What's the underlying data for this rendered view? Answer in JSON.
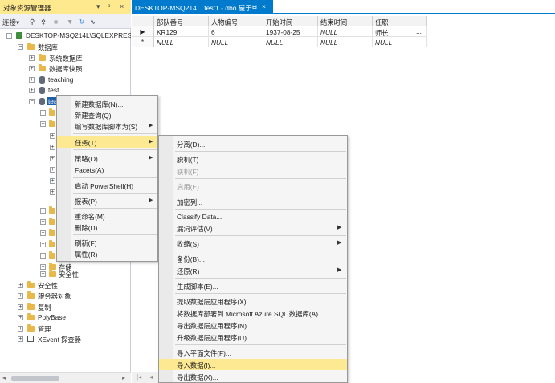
{
  "object_explorer": {
    "title": "对象资源管理器",
    "pin": "ㅈ",
    "float_pin": "ᵖ",
    "close": "×",
    "toolbar": {
      "connect": "连接▾",
      "icons": [
        "plug-icon",
        "disconnect-icon",
        "stop-icon",
        "filter-icon",
        "refresh-icon",
        "activity-icon"
      ]
    },
    "tree": {
      "server": "DESKTOP-MSQ214L\\SQLEXPRESS",
      "databases": "数据库",
      "system_db": "系统数据库",
      "snapshots": "数据库快照",
      "db1": "teaching",
      "db2": "test",
      "db3": "teaching",
      "storage": "存储",
      "security_sub": "安全性",
      "security": "安全性",
      "server_objects": "服务器对象",
      "replication": "复制",
      "polybase": "PolyBase",
      "management": "管理",
      "xevent": "XEvent 探查器"
    }
  },
  "doc_tab": {
    "title": "DESKTOP-MSQ214....test1 - dbo.屋于",
    "pin": "ㅂ",
    "close": "×"
  },
  "grid": {
    "columns": [
      "部队番号",
      "人物编号",
      "开始时间",
      "结束时间",
      "任职"
    ],
    "rows": [
      {
        "marker": "▶",
        "cells": [
          "KR129",
          "6",
          "1937-08-25",
          "NULL",
          "师长"
        ],
        "extra": "..."
      },
      {
        "marker": "*",
        "cells": [
          "NULL",
          "NULL",
          "NULL",
          "NULL",
          "NULL"
        ]
      }
    ]
  },
  "context_menu": {
    "items": [
      "新建数据库(N)...",
      "新建查询(Q)",
      "编写数据库脚本为(S)",
      "任务(T)",
      "策略(O)",
      "Facets(A)",
      "启动 PowerShell(H)",
      "报表(P)",
      "重命名(M)",
      "删除(D)",
      "刷新(F)",
      "属性(R)"
    ]
  },
  "tasks_submenu": {
    "items": [
      "分离(D)...",
      "脱机(T)",
      "联机(F)",
      "启用(E)",
      "加密列...",
      "Classify Data...",
      "漏洞评估(V)",
      "收缩(S)",
      "备份(B)...",
      "还原(R)",
      "生成脚本(E)...",
      "提取数据层应用程序(X)...",
      "将数据库部署到 Microsoft Azure SQL 数据库(A)...",
      "导出数据层应用程序(N)...",
      "升级数据层应用程序(U)...",
      "导入平面文件(F)...",
      "导入数据(I)...",
      "导出数据(X)..."
    ]
  }
}
